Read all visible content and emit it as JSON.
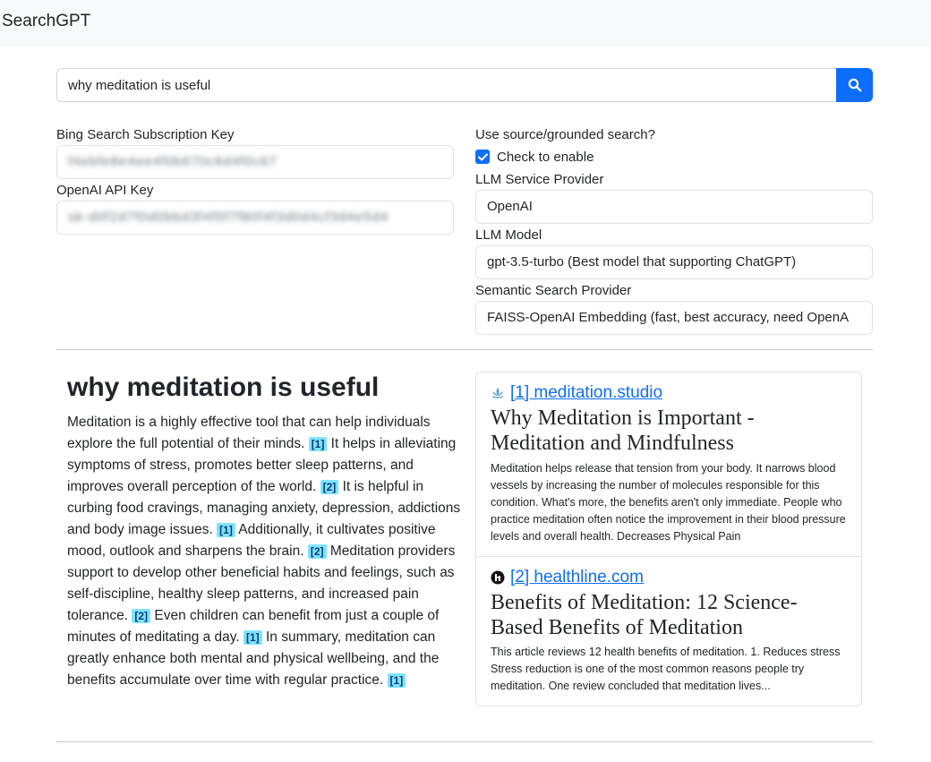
{
  "navbar": {
    "brand": "SearchGPT"
  },
  "search": {
    "query": "why meditation is useful"
  },
  "left_form": {
    "bing_label": "Bing Search Subscription Key",
    "bing_value": "f4ebfe8e4ee4f0b670c6d4f0c67",
    "openai_label": "OpenAI API Key",
    "openai_value": "sk-d0f2d7f0d0bbd3f4f0f7f80f4f3d0d4cf3d4e5d4"
  },
  "right_form": {
    "grounded_label": "Use source/grounded search?",
    "check_label": "Check to enable",
    "llm_provider_label": "LLM Service Provider",
    "llm_provider_value": "OpenAI",
    "llm_model_label": "LLM Model",
    "llm_model_value": "gpt-3.5-turbo (Best model that supporting ChatGPT)",
    "semantic_label": "Semantic Search Provider",
    "semantic_value": "FAISS-OpenAI Embedding (fast, best accuracy, need OpenA"
  },
  "answer": {
    "title": "why meditation is useful",
    "segments": [
      {
        "text": "Meditation is a highly effective tool that can help individuals explore the full potential of their minds. ",
        "cite": "[1]"
      },
      {
        "text": " It helps in alleviating symptoms of stress, promotes better sleep patterns, and improves overall perception of the world. ",
        "cite": "[2]"
      },
      {
        "text": " It is helpful in curbing food cravings, managing anxiety, depression, addictions and body image issues. ",
        "cite": "[1]"
      },
      {
        "text": " Additionally, it cultivates positive mood, outlook and sharpens the brain. ",
        "cite": "[2]"
      },
      {
        "text": " Meditation providers support to develop other beneficial habits and feelings, such as self-discipline, healthy sleep patterns, and increased pain tolerance. ",
        "cite": "[2]"
      },
      {
        "text": " Even children can benefit from just a couple of minutes of meditating a day. ",
        "cite": "[1]"
      },
      {
        "text": " In summary, meditation can greatly enhance both mental and physical wellbeing, and the benefits accumulate over time with regular practice. ",
        "cite": "[1]"
      }
    ]
  },
  "sources": [
    {
      "label": "[1] meditation.studio",
      "icon": "lotus-icon",
      "title": "Why Meditation is Important - Meditation and Mindfulness",
      "snippet": "Meditation helps release that tension from your body. It narrows blood vessels by increasing the number of molecules responsible for this condition. What's more, the benefits aren't only immediate. People who practice meditation often notice the improvement in their blood pressure levels and overall health. Decreases Physical Pain"
    },
    {
      "label": "[2] healthline.com",
      "icon": "healthline-logo-icon",
      "title": "Benefits of Meditation: 12 Science-Based Benefits of Meditation",
      "snippet": "This article reviews 12 health benefits of meditation. 1. Reduces stress Stress reduction is one of the most common reasons people try meditation. One review concluded that meditation lives..."
    }
  ],
  "colors": {
    "primary": "#0d6efd",
    "citation_bg": "#7fe3ff",
    "navbar_bg": "#f8f9fa"
  }
}
